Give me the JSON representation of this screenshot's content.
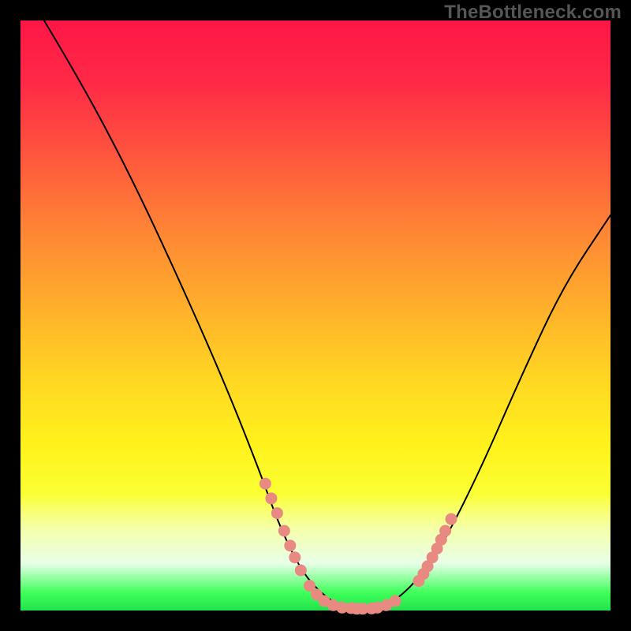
{
  "watermark": "TheBottleneck.com",
  "colors": {
    "frame_bg": "#000000",
    "dot_fill": "#e88a82",
    "curve_stroke": "#000000"
  },
  "chart_data": {
    "type": "line",
    "title": "",
    "xlabel": "",
    "ylabel": "",
    "xlim": [
      0,
      100
    ],
    "ylim": [
      0,
      100
    ],
    "grid": false,
    "curve": {
      "name": "bottleneck-curve",
      "points_xy": [
        [
          4,
          100
        ],
        [
          10,
          90
        ],
        [
          18,
          75
        ],
        [
          26,
          58
        ],
        [
          34,
          40
        ],
        [
          40,
          25
        ],
        [
          44,
          14
        ],
        [
          48,
          6
        ],
        [
          52,
          2
        ],
        [
          55,
          0.5
        ],
        [
          58,
          0
        ],
        [
          61,
          0.5
        ],
        [
          64,
          2
        ],
        [
          68,
          6
        ],
        [
          72,
          12
        ],
        [
          78,
          24
        ],
        [
          85,
          40
        ],
        [
          92,
          55
        ],
        [
          100,
          67
        ]
      ]
    },
    "dots": {
      "name": "highlighted-points",
      "points_xy": [
        [
          41.5,
          21.5
        ],
        [
          42.5,
          19.0
        ],
        [
          43.5,
          16.5
        ],
        [
          44.7,
          13.5
        ],
        [
          45.7,
          11.0
        ],
        [
          46.5,
          9.0
        ],
        [
          47.5,
          6.8
        ],
        [
          49.0,
          4.2
        ],
        [
          50.2,
          2.7
        ],
        [
          51.5,
          1.6
        ],
        [
          53.0,
          0.9
        ],
        [
          54.5,
          0.5
        ],
        [
          56.0,
          0.4
        ],
        [
          57.0,
          0.3
        ],
        [
          58.0,
          0.3
        ],
        [
          59.5,
          0.35
        ],
        [
          60.5,
          0.5
        ],
        [
          62.0,
          0.9
        ],
        [
          63.5,
          1.6
        ],
        [
          67.5,
          5.0
        ],
        [
          68.3,
          6.2
        ],
        [
          69.0,
          7.5
        ],
        [
          69.8,
          9.0
        ],
        [
          70.6,
          10.5
        ],
        [
          71.3,
          12.0
        ],
        [
          72.0,
          13.5
        ],
        [
          73.0,
          15.5
        ]
      ]
    }
  }
}
